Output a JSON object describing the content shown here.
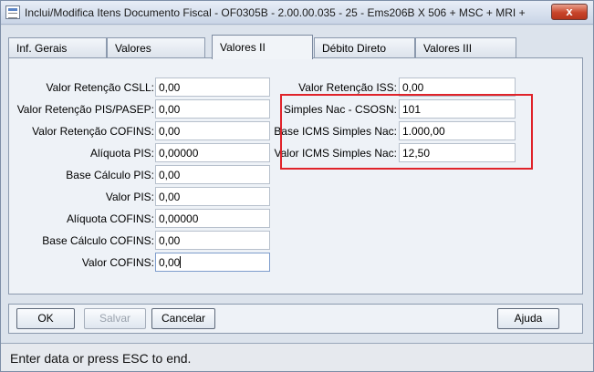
{
  "window": {
    "title": "Inclui/Modifica Itens Documento Fiscal - OF0305B - 2.00.00.035 - 25 - Ems206B X 506 + MSC + MRI +",
    "close_glyph": "x"
  },
  "tabs": [
    {
      "label": "Inf. Gerais",
      "active": false
    },
    {
      "label": "Valores",
      "active": false
    },
    {
      "label": "Valores II",
      "active": true
    },
    {
      "label": "Débito Direto",
      "active": false
    },
    {
      "label": "Valores III",
      "active": false
    }
  ],
  "left_fields": [
    {
      "label": "Valor Retenção CSLL:",
      "value": "0,00"
    },
    {
      "label": "Valor Retenção PIS/PASEP:",
      "value": "0,00"
    },
    {
      "label": "Valor Retenção COFINS:",
      "value": "0,00"
    },
    {
      "label": "Alíquota PIS:",
      "value": "0,00000"
    },
    {
      "label": "Base Cálculo PIS:",
      "value": "0,00"
    },
    {
      "label": "Valor PIS:",
      "value": "0,00"
    },
    {
      "label": "Alíquota COFINS:",
      "value": "0,00000"
    },
    {
      "label": "Base Cálculo COFINS:",
      "value": "0,00"
    },
    {
      "label": "Valor COFINS:",
      "value": "0,00"
    }
  ],
  "right_fields": [
    {
      "label": "Valor Retenção ISS:",
      "value": "0,00"
    },
    {
      "label": "Simples Nac - CSOSN:",
      "value": "101"
    },
    {
      "label": "Base ICMS Simples Nac:",
      "value": "1.000,00"
    },
    {
      "label": "Valor ICMS Simples Nac:",
      "value": "12,50"
    }
  ],
  "buttons": {
    "ok": "OK",
    "salvar": "Salvar",
    "cancelar": "Cancelar",
    "ajuda": "Ajuda"
  },
  "status": {
    "text": "Enter data or press ESC to end."
  },
  "colors": {
    "highlight": "#e0232a"
  }
}
